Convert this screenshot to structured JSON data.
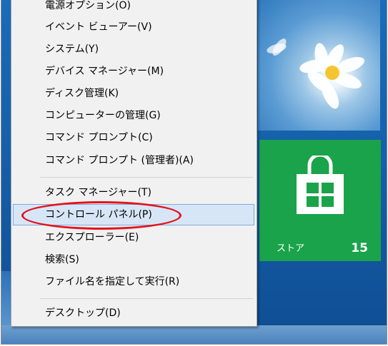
{
  "menu": {
    "items": [
      {
        "label": "電源オプション(O)"
      },
      {
        "label": "イベント ビューアー(V)"
      },
      {
        "label": "システム(Y)"
      },
      {
        "label": "デバイス マネージャー(M)"
      },
      {
        "label": "ディスク管理(K)"
      },
      {
        "label": "コンピューターの管理(G)"
      },
      {
        "label": "コマンド プロンプト(C)"
      },
      {
        "label": "コマンド プロンプト (管理者)(A)"
      },
      {
        "label": "タスク マネージャー(T)"
      },
      {
        "label": "コントロール パネル(P)"
      },
      {
        "label": "エクスプローラー(E)"
      },
      {
        "label": "検索(S)"
      },
      {
        "label": "ファイル名を指定して実行(R)"
      },
      {
        "label": "デスクトップ(D)"
      }
    ],
    "highlighted_item": "コントロール パネル(P)"
  },
  "tiles": {
    "store": {
      "label": "ストア",
      "badge": "15",
      "icon": "store-bag-icon",
      "color": "#1aa34a"
    },
    "photo": {
      "icon": "flower-photo"
    }
  },
  "annotation": {
    "circle_color": "#e3141c"
  }
}
